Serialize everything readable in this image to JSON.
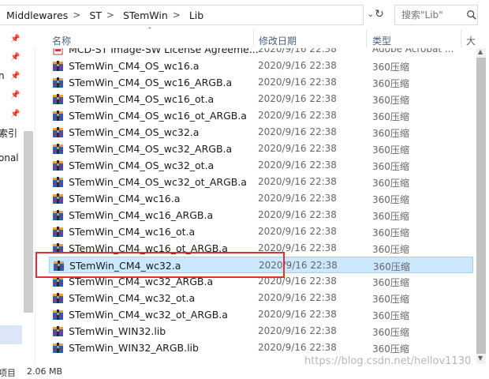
{
  "address": {
    "crumbs": [
      "Middlewares",
      "ST",
      "STemWin",
      "Lib"
    ],
    "separator": ">"
  },
  "search": {
    "placeholder": "搜索\"Lib\""
  },
  "nav": {
    "partial_labels": [
      "n",
      "索引",
      "onal"
    ]
  },
  "columns": {
    "name": "名称",
    "date": "修改日期",
    "type": "类型",
    "size": "大"
  },
  "files": [
    {
      "name": "MCD-ST Image-SW License Agreeme...",
      "date": "2020/9/16 22:38",
      "type": "Adobe Acrobat ...",
      "icon": "pdf-icon"
    },
    {
      "name": "STemWin_CM4_OS_wc16.a",
      "date": "2020/9/16 22:38",
      "type": "360压缩",
      "icon": "archive-icon"
    },
    {
      "name": "STemWin_CM4_OS_wc16_ARGB.a",
      "date": "2020/9/16 22:38",
      "type": "360压缩",
      "icon": "archive-icon"
    },
    {
      "name": "STemWin_CM4_OS_wc16_ot.a",
      "date": "2020/9/16 22:38",
      "type": "360压缩",
      "icon": "archive-icon"
    },
    {
      "name": "STemWin_CM4_OS_wc16_ot_ARGB.a",
      "date": "2020/9/16 22:38",
      "type": "360压缩",
      "icon": "archive-icon"
    },
    {
      "name": "STemWin_CM4_OS_wc32.a",
      "date": "2020/9/16 22:38",
      "type": "360压缩",
      "icon": "archive-icon"
    },
    {
      "name": "STemWin_CM4_OS_wc32_ARGB.a",
      "date": "2020/9/16 22:38",
      "type": "360压缩",
      "icon": "archive-icon"
    },
    {
      "name": "STemWin_CM4_OS_wc32_ot.a",
      "date": "2020/9/16 22:38",
      "type": "360压缩",
      "icon": "archive-icon"
    },
    {
      "name": "STemWin_CM4_OS_wc32_ot_ARGB.a",
      "date": "2020/9/16 22:38",
      "type": "360压缩",
      "icon": "archive-icon"
    },
    {
      "name": "STemWin_CM4_wc16.a",
      "date": "2020/9/16 22:38",
      "type": "360压缩",
      "icon": "archive-icon"
    },
    {
      "name": "STemWin_CM4_wc16_ARGB.a",
      "date": "2020/9/16 22:38",
      "type": "360压缩",
      "icon": "archive-icon"
    },
    {
      "name": "STemWin_CM4_wc16_ot.a",
      "date": "2020/9/16 22:38",
      "type": "360压缩",
      "icon": "archive-icon"
    },
    {
      "name": "STemWin_CM4_wc16_ot_ARGB.a",
      "date": "2020/9/16 22:38",
      "type": "360压缩",
      "icon": "archive-icon"
    },
    {
      "name": "STemWin_CM4_wc32.a",
      "date": "2020/9/16 22:38",
      "type": "360压缩",
      "icon": "archive-icon",
      "selected": true
    },
    {
      "name": "STemWin_CM4_wc32_ARGB.a",
      "date": "2020/9/16 22:38",
      "type": "360压缩",
      "icon": "archive-icon"
    },
    {
      "name": "STemWin_CM4_wc32_ot.a",
      "date": "2020/9/16 22:38",
      "type": "360压缩",
      "icon": "archive-icon"
    },
    {
      "name": "STemWin_CM4_wc32_ot_ARGB.a",
      "date": "2020/9/16 22:38",
      "type": "360压缩",
      "icon": "archive-icon"
    },
    {
      "name": "STemWin_WIN32.lib",
      "date": "2020/9/16 22:38",
      "type": "360压缩",
      "icon": "archive-icon"
    },
    {
      "name": "STemWin_WIN32_ARGB.lib",
      "date": "2020/9/16 22:38",
      "type": "360压缩",
      "icon": "archive-icon"
    }
  ],
  "status": {
    "left": "项目",
    "size": "2.06 MB"
  },
  "watermark": "https://blog.csdn.net/hellov1130",
  "colors": {
    "selection": "#cce8ff",
    "highlight_box": "#e03030",
    "header_text": "#4c607a"
  }
}
